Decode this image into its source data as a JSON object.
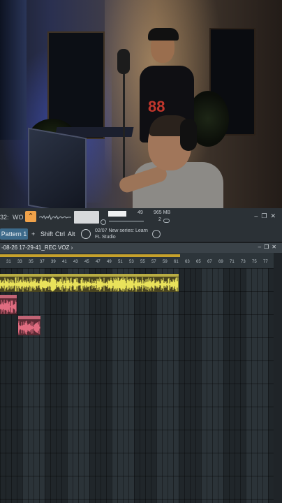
{
  "toolbar": {
    "tempo_partial": "32:",
    "mode_label": "WO",
    "cpu_value": "49",
    "memory": "965 MB",
    "poly": "2",
    "icons": [
      "minimize-icon",
      "restore-icon",
      "close-icon"
    ]
  },
  "toolbar2": {
    "pattern_label": "Pattern 1",
    "plus_label": "+",
    "shift_label": "Shift",
    "ctrl_label": "Ctrl",
    "alt_label": "Alt",
    "news_date": "02/07",
    "news_line1": "New series: Learn",
    "news_line2": "FL Studio"
  },
  "playlist": {
    "title": "-08-26 17-29-41_REC VOZ",
    "arrow": "›",
    "window_controls": [
      "minimize-icon",
      "restore-icon",
      "close-icon"
    ],
    "ticks": [
      "31",
      "33",
      "35",
      "37",
      "39",
      "41",
      "43",
      "45",
      "47",
      "49",
      "51",
      "53",
      "55",
      "57",
      "59",
      "61",
      "63",
      "65",
      "67",
      "69",
      "71",
      "73",
      "75",
      "77"
    ]
  },
  "colors": {
    "loop_bar": "#c6a12b",
    "audio_clip_yellow": "#e9e25b",
    "audio_clip_pink": "#e06c80",
    "accent_orange": "#f0a24a",
    "pattern_blue": "#3d6a8a"
  }
}
